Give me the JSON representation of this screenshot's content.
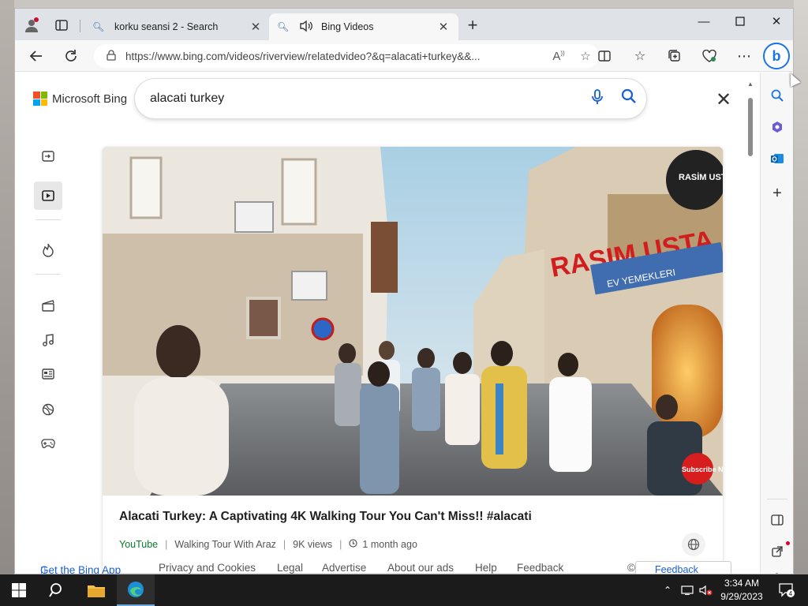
{
  "tabs": [
    {
      "title": "korku seansi 2 - Search",
      "favicon": "search-icon"
    },
    {
      "title": "Bing Videos",
      "favicon": "search-icon",
      "audio": "speaker-icon"
    }
  ],
  "address_bar": {
    "url": "https://www.bing.com/videos/riverview/relatedvideo?&q=alacati+turkey&&..."
  },
  "bing_page": {
    "logo_text": "Microsoft Bing",
    "search_query": "alacati turkey",
    "video": {
      "title": "Alacati Turkey: A Captivating 4K Walking Tour You Can't Miss!! #alacati",
      "source": "YouTube",
      "channel": "Walking Tour With Araz",
      "views": "9K views",
      "age": "1 month ago",
      "thumbnail_text": {
        "shop_name": "RASIM USTA",
        "shop_sub": "EV YEMEKLERI",
        "sign_text": "RASİM USTA",
        "watermark": "Subscribe NOW"
      }
    },
    "footer": {
      "get_app": "Get the Bing App",
      "privacy": "Privacy and Cookies",
      "legal": "Legal",
      "advertise": "Advertise",
      "about_ads": "About our ads",
      "help": "Help",
      "feedback": "Feedback",
      "copyright": "©",
      "feedback_button": "Feedback"
    }
  },
  "taskbar": {
    "time": "3:34 AM",
    "date": "9/29/2023",
    "notification_count": "4"
  },
  "colors": {
    "accent": "#1a5fd1",
    "source_green": "#0b7a2a",
    "taskbar": "#1b1b1b"
  }
}
